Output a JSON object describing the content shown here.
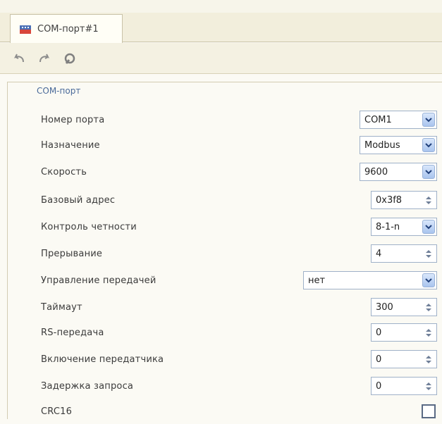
{
  "tab": {
    "label": "COM-порт#1"
  },
  "toolbar": {
    "undo": "undo-icon",
    "redo": "redo-icon",
    "tools": "tools-icon"
  },
  "section": {
    "title": "COM-порт"
  },
  "fields": [
    {
      "label": "Номер порта",
      "value": "COM1",
      "control": "dropdown"
    },
    {
      "label": "Назначение",
      "value": "Modbus",
      "control": "dropdown"
    },
    {
      "label": "Скорость",
      "value": "9600",
      "control": "dropdown"
    },
    {
      "label": "Базовый адрес",
      "value": "0x3f8",
      "control": "spinner"
    },
    {
      "label": "Контроль четности",
      "value": "8-1-n",
      "control": "dropdown"
    },
    {
      "label": "Прерывание",
      "value": "4",
      "control": "spinner"
    },
    {
      "label": "Управление передачей",
      "value": "нет",
      "control": "dropdown"
    },
    {
      "label": "Таймаут",
      "value": "300",
      "control": "spinner"
    },
    {
      "label": "RS-передача",
      "value": "0",
      "control": "spinner"
    },
    {
      "label": "Включение передатчика",
      "value": "0",
      "control": "spinner"
    },
    {
      "label": "Задержка запроса",
      "value": "0",
      "control": "spinner"
    },
    {
      "label": "CRC16",
      "checked": false,
      "control": "checkbox"
    }
  ]
}
